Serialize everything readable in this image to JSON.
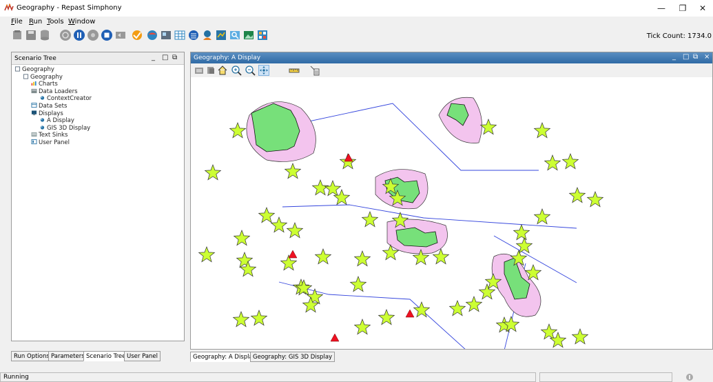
{
  "window": {
    "title": "Geography - Repast Simphony"
  },
  "menu": [
    "File",
    "Run",
    "Tools",
    "Window"
  ],
  "menu_accel": [
    "F",
    "R",
    "T",
    "W"
  ],
  "toolbar": {
    "tick_label": "Tick Count: 1734.0"
  },
  "left_panel": {
    "title": "Scenario Tree",
    "tree": [
      {
        "label": "Geography",
        "depth": 0,
        "icon": "context-icon"
      },
      {
        "label": "Geography",
        "depth": 1,
        "icon": "context-icon"
      },
      {
        "label": "Charts",
        "depth": 2,
        "icon": "chart-icon"
      },
      {
        "label": "Data Loaders",
        "depth": 2,
        "icon": "database-icon"
      },
      {
        "label": "ContextCreator",
        "depth": 3,
        "icon": "bullet-icon"
      },
      {
        "label": "Data Sets",
        "depth": 2,
        "icon": "table-icon"
      },
      {
        "label": "Displays",
        "depth": 2,
        "icon": "monitor-icon"
      },
      {
        "label": "A Display",
        "depth": 3,
        "icon": "bullet-icon"
      },
      {
        "label": "GIS 3D Display",
        "depth": 3,
        "icon": "bullet-icon"
      },
      {
        "label": "Text Sinks",
        "depth": 2,
        "icon": "text-sink-icon"
      },
      {
        "label": "User Panel",
        "depth": 2,
        "icon": "user-panel-icon"
      }
    ],
    "tabs": [
      "Run Options",
      "Parameters",
      "Scenario Tree",
      "User Panel"
    ],
    "active_tab": "Scenario Tree"
  },
  "display_panel": {
    "title": "Geography: A Display",
    "tabs": [
      "Geography: A Display",
      "Geography: GIS 3D Display"
    ],
    "active_tab": "Geography: A Display"
  },
  "status": {
    "text": "Running"
  },
  "colors": {
    "star_fill": "#ccff33",
    "polygon_fill": "#77e07a",
    "buffer_fill": "#f3c4ee",
    "line": "#3344dd",
    "triangle": "#ee1122",
    "display_header": "#3d78b5"
  }
}
